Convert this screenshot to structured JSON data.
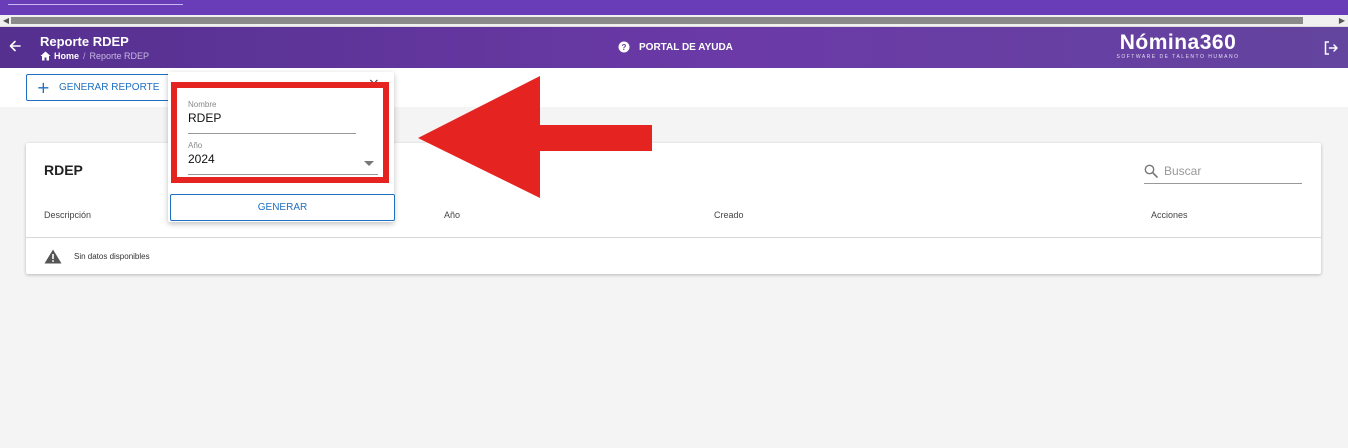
{
  "header": {
    "title": "Reporte RDEP",
    "breadcrumb": {
      "home": "Home",
      "current": "Reporte RDEP"
    },
    "help_label": "PORTAL DE AYUDA",
    "logo": {
      "name": "Nómina360",
      "tagline": "SOFTWARE DE TALENTO HUMANO"
    }
  },
  "toolbar": {
    "generate_report_label": "GENERAR REPORTE"
  },
  "card": {
    "title": "RDEP",
    "search_placeholder": "Buscar",
    "columns": [
      "Descripción",
      "Año",
      "Creado",
      "Acciones"
    ],
    "empty_message": "Sin datos disponibles"
  },
  "popup": {
    "name_label": "Nombre",
    "name_value": "RDEP",
    "year_label": "Año",
    "year_value": "2024",
    "generate_label": "GENERAR",
    "close_glyph": "×"
  },
  "colors": {
    "header_purple": "#6b3aa7",
    "accent_blue": "#1e6fc0",
    "annotation_red": "#e52321"
  },
  "icons": {
    "back": "arrow-left-icon",
    "home": "home-icon",
    "help": "help-circle-icon",
    "logout": "logout-icon",
    "plus": "plus-icon",
    "search": "search-icon",
    "warning": "warning-icon",
    "dropdown": "caret-down-icon",
    "close": "close-icon"
  }
}
